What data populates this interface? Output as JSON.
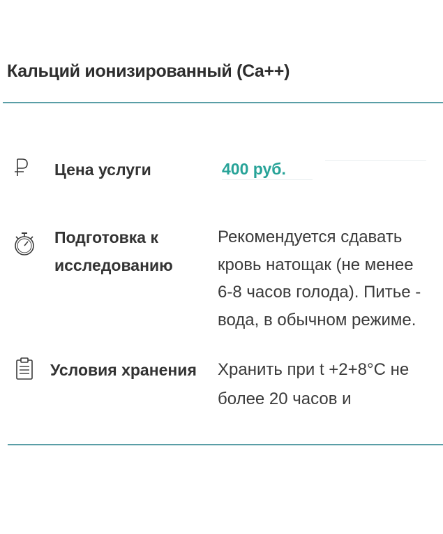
{
  "title": "Кальций ионизированный (Ca++)",
  "rows": [
    {
      "icon": "ruble-icon",
      "label": "Цена услуги",
      "value": "400 руб."
    },
    {
      "icon": "stopwatch-icon",
      "label_lines": [
        "Подготовка к",
        "исследованию"
      ],
      "value_lines": [
        "Рекомендуется сдавать",
        "кровь натощак (не менее",
        "6-8 часов голода). Питье -",
        "вода, в обычном режиме."
      ]
    },
    {
      "icon": "clipboard-icon",
      "label": "Условия хранения",
      "value_lines": [
        "Хранить при t +2+8°С не",
        "более 20 часов и"
      ]
    }
  ],
  "colors": {
    "accent": "#27a398",
    "divider": "#5a9ea6"
  }
}
